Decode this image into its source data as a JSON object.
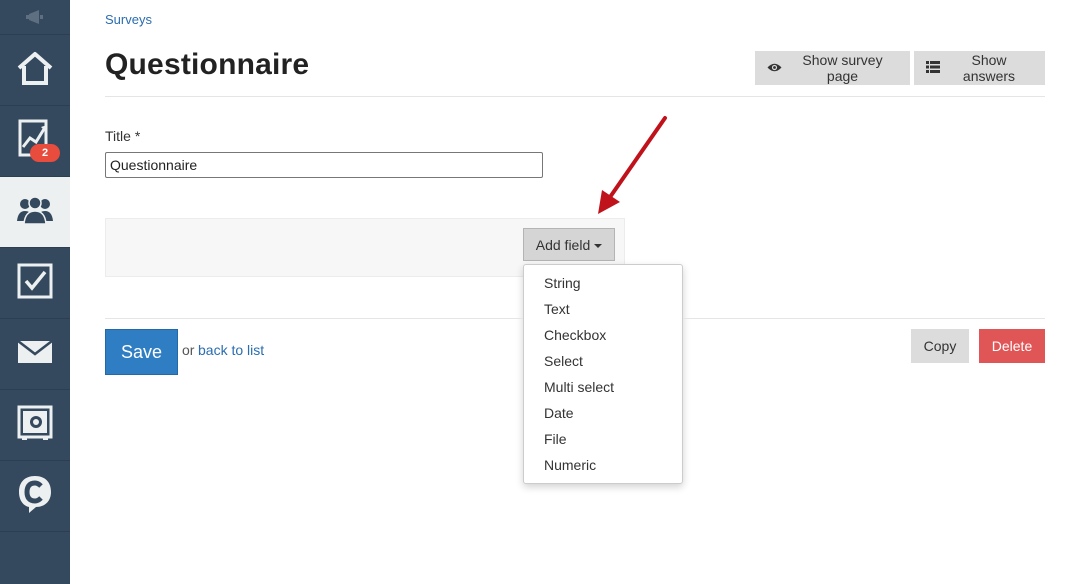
{
  "sidebar": {
    "items": [
      {
        "icon": "home-icon"
      },
      {
        "icon": "chart-icon",
        "badge": "2"
      },
      {
        "icon": "users-icon",
        "active": true
      },
      {
        "icon": "checkbox-icon"
      },
      {
        "icon": "mail-icon"
      },
      {
        "icon": "safe-icon"
      },
      {
        "icon": "chat-logo-icon"
      }
    ]
  },
  "breadcrumb": "Surveys",
  "page_title": "Questionnaire",
  "header_buttons": {
    "show_survey_page": "Show survey page",
    "show_answers": "Show answers"
  },
  "form": {
    "title_label": "Title *",
    "title_value": "Questionnaire"
  },
  "add_field": {
    "label": "Add field",
    "options": [
      "String",
      "Text",
      "Checkbox",
      "Select",
      "Multi select",
      "Date",
      "File",
      "Numeric"
    ]
  },
  "footer": {
    "save": "Save",
    "or_text": "or",
    "back_link": "back to list",
    "copy": "Copy",
    "delete": "Delete"
  },
  "colors": {
    "sidebar_bg": "#34495e",
    "link": "#2a6db0",
    "primary": "#2f7ec4",
    "danger": "#e05656",
    "annotation_arrow": "#c0121b"
  }
}
